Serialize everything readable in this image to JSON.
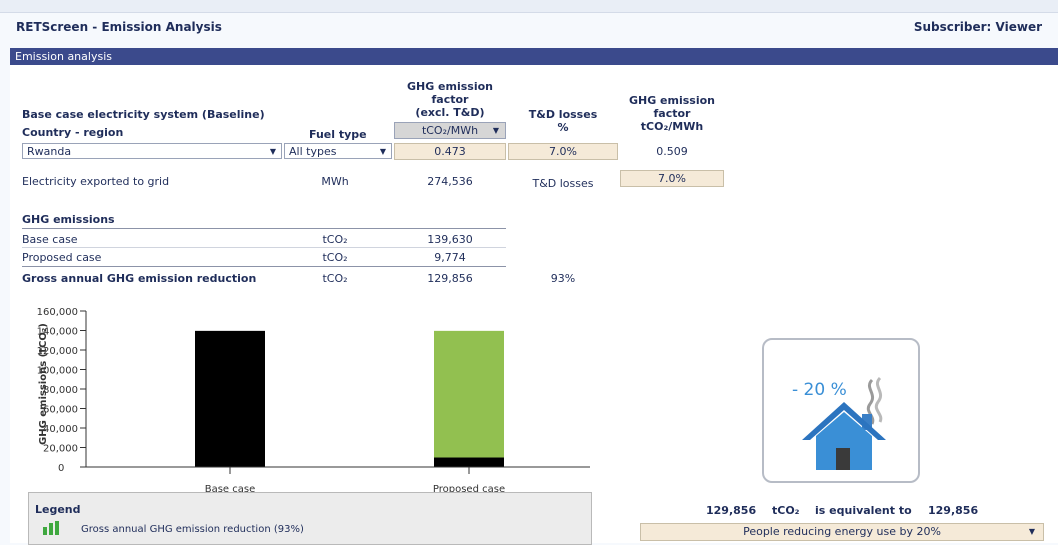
{
  "app": {
    "title": "RETScreen - Emission Analysis",
    "subscriber": "Subscriber: Viewer"
  },
  "section": {
    "title": "Emission analysis"
  },
  "baseline": {
    "heading": "Base case electricity system (Baseline)",
    "country_label": "Country - region",
    "country_value": "Rwanda",
    "fuel_type_label": "Fuel type",
    "fuel_type_value": "All types",
    "ghg_factor_header_1": "GHG emission",
    "ghg_factor_header_2": "factor",
    "ghg_factor_header_3": "(excl. T&D)",
    "ghg_factor_unit": "tCO₂/MWh",
    "ghg_factor_value": "0.473",
    "td_losses_header_1": "T&D losses",
    "td_losses_header_2": "%",
    "td_losses_value": "7.0%",
    "ghg_factor2_header_1": "GHG emission",
    "ghg_factor2_header_2": "factor",
    "ghg_factor2_header_3": "tCO₂/MWh",
    "ghg_factor2_value": "0.509"
  },
  "export": {
    "label": "Electricity exported to grid",
    "unit": "MWh",
    "value": "274,536",
    "td_label": "T&D losses",
    "td_value": "7.0%"
  },
  "ghg": {
    "heading": "GHG emissions",
    "rows": [
      {
        "label": "Base case",
        "unit": "tCO₂",
        "value": "139,630"
      },
      {
        "label": "Proposed case",
        "unit": "tCO₂",
        "value": "9,774"
      }
    ],
    "gross_label": "Gross annual GHG emission reduction",
    "gross_unit": "tCO₂",
    "gross_value": "129,856",
    "gross_pct": "93%"
  },
  "chart_data": {
    "type": "bar",
    "categories": [
      "Base case",
      "Proposed case"
    ],
    "ylabel": "GHG emissions (tCO₂)",
    "ylim": [
      0,
      160000
    ],
    "yticks": [
      "160,000",
      "140,000",
      "120,000",
      "100,000",
      "80,000",
      "60,000",
      "40,000",
      "20,000",
      "0"
    ],
    "base_case": 139630,
    "proposed_case": 9774,
    "reduction": 129856,
    "colors": {
      "emission": "#000000",
      "reduction": "#92c050"
    }
  },
  "legend": {
    "title": "Legend",
    "item": "Gross annual GHG emission reduction (93%)"
  },
  "equivalent": {
    "icon_label": "- 20 %",
    "value_left": "129,856",
    "unit": "tCO₂",
    "text": "is equivalent to",
    "value_right": "129,856",
    "selection": "People reducing energy use by 20%"
  }
}
